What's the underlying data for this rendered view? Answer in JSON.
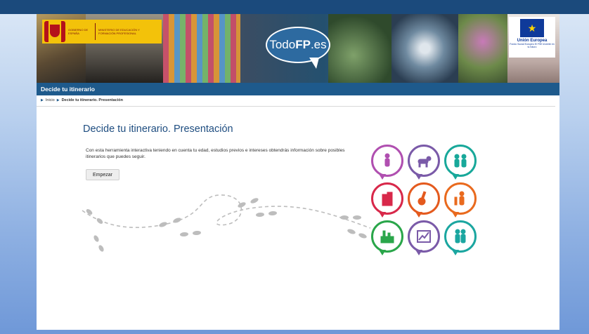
{
  "header": {
    "gov_text_1": "GOBIERNO DE ESPAÑA",
    "gov_text_2": "MINISTERIO DE EDUCACIÓN Y FORMACIÓN PROFESIONAL",
    "logo_text_1": "Todo",
    "logo_text_2": "FP",
    "logo_text_3": ".es",
    "eu_title": "Unión Europea",
    "eu_sub": "Fondo Social Europeo El FSE invierte en tu futuro"
  },
  "nav": {
    "section_title": "Decide tu itinerario"
  },
  "breadcrumb": {
    "home": "Inicio",
    "current": "Decide tu itinerario. Presentación"
  },
  "main": {
    "title": "Decide tu itinerario. Presentación",
    "description": "Con esta herramienta interactiva teniendo en cuenta tu edad, estudios previos e intereses obtendrás información sobre posibles itinerarios que puedes seguir.",
    "start_button": "Empezar"
  },
  "icon_grid": [
    {
      "name": "person-icon",
      "color": "#b04fb0"
    },
    {
      "name": "animal-icon",
      "color": "#7a5aa8"
    },
    {
      "name": "people-icon",
      "color": "#18a89a"
    },
    {
      "name": "building-icon",
      "color": "#d8284a"
    },
    {
      "name": "guitar-icon",
      "color": "#e45a1e"
    },
    {
      "name": "worker-icon",
      "color": "#e96a1e"
    },
    {
      "name": "industry-icon",
      "color": "#2aa64a"
    },
    {
      "name": "chart-icon",
      "color": "#7a5aa8"
    },
    {
      "name": "care-icon",
      "color": "#1ba6a0"
    }
  ],
  "colors": {
    "brand_blue": "#1e5a8c",
    "title_blue": "#1e4d80"
  }
}
